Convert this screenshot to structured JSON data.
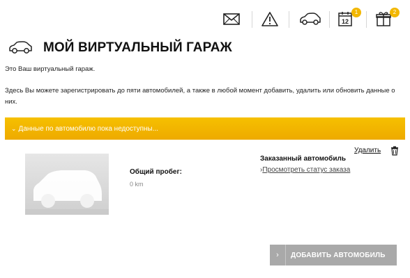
{
  "header": {
    "icons": [
      {
        "name": "envelope-icon",
        "badge": ""
      },
      {
        "name": "warning-icon",
        "badge": ""
      },
      {
        "name": "car-icon",
        "badge": ""
      },
      {
        "name": "calendar-icon",
        "badge": "1",
        "calendar_day": "12"
      },
      {
        "name": "gift-icon",
        "badge": "2"
      }
    ],
    "accent_color": "#f2b700"
  },
  "page": {
    "title": "МОЙ ВИРТУАЛЬНЫЙ ГАРАЖ",
    "intro_line1": "Это Ваш виртуальный гараж.",
    "intro_line2": "Здесь Вы можете зарегистрировать до пяти автомобилей, а также в любой момент добавить, удалить или обновить данные о них."
  },
  "notice": {
    "chevron": "⌄",
    "text": "Данные по автомобилю пока недоступны...",
    "color": "#f4b800"
  },
  "vehicle": {
    "mileage_label": "Общий пробег:",
    "mileage_value": "0 km",
    "delete_label": "Удалить",
    "ordered_label": "Заказанный автомобиль",
    "status_link_arrow": "›",
    "status_link": "Просмотреть статус заказа"
  },
  "actions": {
    "add_arrow": "›",
    "add_vehicle": "ДОБАВИТЬ АВТОМОБИЛЬ"
  }
}
